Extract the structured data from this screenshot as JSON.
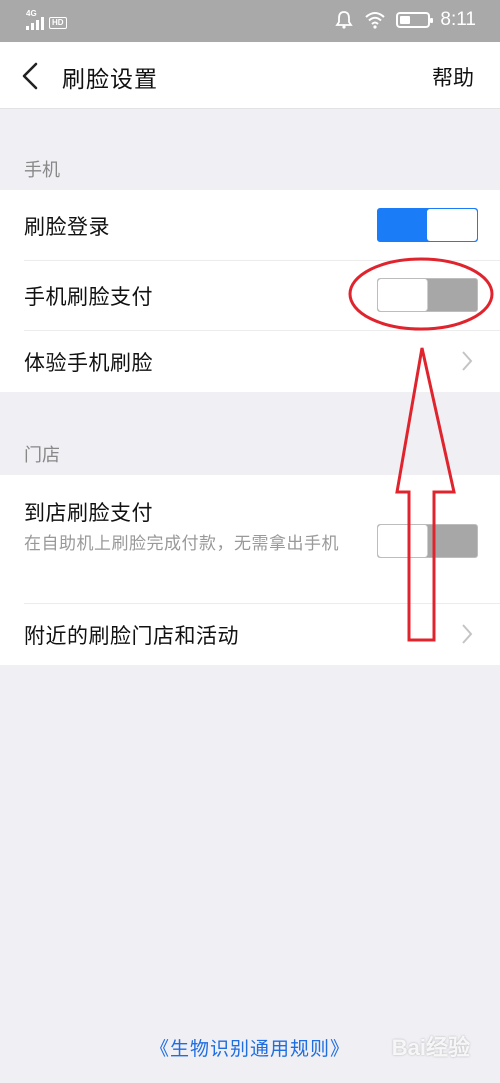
{
  "status_bar": {
    "network": "4G",
    "hd": "HD",
    "time": "8:11"
  },
  "nav": {
    "title": "刷脸设置",
    "help": "帮助"
  },
  "sections": {
    "phone": {
      "header": "手机",
      "rows": [
        {
          "label": "刷脸登录",
          "toggle": "on"
        },
        {
          "label": "手机刷脸支付",
          "toggle": "off"
        },
        {
          "label": "体验手机刷脸"
        }
      ]
    },
    "store": {
      "header": "门店",
      "rows": [
        {
          "label": "到店刷脸支付",
          "sub": "在自助机上刷脸完成付款，无需拿出手机",
          "toggle": "off"
        },
        {
          "label": "附近的刷脸门店和活动"
        }
      ]
    }
  },
  "footer": {
    "link": "《生物识别通用规则》"
  },
  "colors": {
    "accent": "#1a7cf7",
    "toggle_off": "#a7a7a7",
    "annotation": "#e0242d",
    "status_bar": "#a9a9a9"
  },
  "watermark": "Bai经验"
}
